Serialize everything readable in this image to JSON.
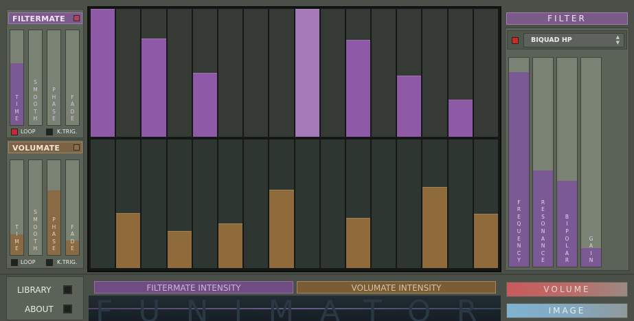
{
  "filtermate": {
    "title": "FILTERMATE",
    "color": "#7c5a8c",
    "toggle_color": "#b8415a",
    "sliders": [
      {
        "label": "TIME",
        "value": 0.65
      },
      {
        "label": "SMOOTH",
        "value": 0.0
      },
      {
        "label": "PHASE",
        "value": 0.0
      },
      {
        "label": "FADE",
        "value": 0.0
      }
    ],
    "loop_label": "LOOP",
    "ktrig_label": "K.TRIG."
  },
  "volumate": {
    "title": "VOLUMATE",
    "color": "#7d6246",
    "toggle_color": "#8e6e47",
    "sliders": [
      {
        "label": "TIME",
        "value": 0.22
      },
      {
        "label": "SMOOTH",
        "value": 0.0
      },
      {
        "label": "PHASE",
        "value": 0.68
      },
      {
        "label": "FADE",
        "value": 0.15
      }
    ],
    "loop_label": "LOOP",
    "ktrig_label": "K.TRIG."
  },
  "sequencer": {
    "steps": 16,
    "filter_values": [
      1.0,
      0.0,
      0.77,
      0.0,
      0.5,
      0.0,
      0.0,
      0.0,
      1.0,
      0.0,
      0.76,
      0.0,
      0.48,
      0.0,
      0.29,
      0.0
    ],
    "volume_values": [
      0.0,
      0.43,
      0.0,
      0.29,
      0.0,
      0.35,
      0.0,
      0.61,
      0.0,
      0.0,
      0.39,
      0.0,
      0.0,
      0.63,
      0.0,
      0.42
    ],
    "active_step": 8,
    "filter_color": "#8e5aa8",
    "volume_color": "#8f6b3c"
  },
  "filter": {
    "title": "FILTER",
    "type_value": "BIQUAD HP",
    "sliders": [
      {
        "label": "FREQUENCY",
        "value": 0.93
      },
      {
        "label": "RESONANCE",
        "value": 0.46
      },
      {
        "label": "BIPOLAR",
        "value": 0.41
      },
      {
        "label": "GAIN",
        "value": 0.09
      }
    ]
  },
  "bottom": {
    "library_label": "LIBRARY",
    "about_label": "ABOUT",
    "filtermate_intensity_label": "FILTERMATE INTENSITY",
    "volumate_intensity_label": "VOLUMATE INTENSITY",
    "volume_label": "VOLUME",
    "image_label": "IMAGE",
    "logo_text": "FUNIMATOR"
  }
}
